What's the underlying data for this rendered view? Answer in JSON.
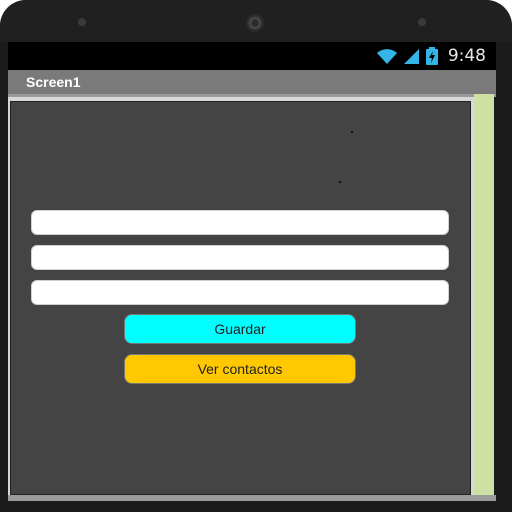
{
  "status_bar": {
    "time": "9:48"
  },
  "app": {
    "title": "Screen1"
  },
  "form": {
    "field1_value": "",
    "field2_value": "",
    "field3_value": "",
    "save_label": "Guardar",
    "view_contacts_label": "Ver contactos"
  },
  "colors": {
    "save_button": "#00ffff",
    "view_contacts_button": "#ffc800",
    "screen_background": "#444444",
    "scroll_strip": "#cfe0a4"
  }
}
